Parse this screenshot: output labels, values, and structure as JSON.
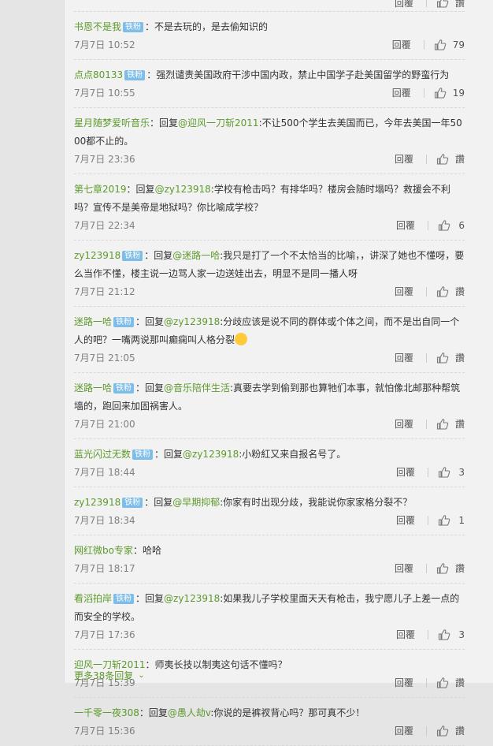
{
  "top_meta": {
    "reply_label": "回覆",
    "like_label": "讚"
  },
  "comments": [
    {
      "user": "书恩不是我",
      "badge": "铁粉",
      "reply_prefix": "",
      "mention": "",
      "content": "：不是去玩的，是去偷知识的",
      "time": "7月7日 10:52",
      "reply_label": "回覆",
      "likes": "79"
    },
    {
      "user": "点点80133",
      "badge": "铁粉",
      "reply_prefix": "",
      "mention": "",
      "content": "：强烈谴责美国政府干涉中国内政，禁止中国学子赴美国留学的野蛮行为",
      "time": "7月7日 10:55",
      "reply_label": "回覆",
      "likes": "19"
    },
    {
      "user": "星月随梦爱听音乐",
      "badge": "",
      "reply_prefix": "：回复",
      "mention": "@迎风一刀斩2011",
      "content": ":不让500个学生去美国而已，今年去美国一年5000都不止的。",
      "time": "7月7日 23:36",
      "reply_label": "回覆",
      "likes": "讚"
    },
    {
      "user": "第七章2019",
      "badge": "",
      "reply_prefix": "：回复",
      "mention": "@zy123918",
      "content": ":学校有枪击吗？有排华吗？楼房会随时塌吗？救援会不利吗？宣传不是美帝是地狱吗？你比喻成学校？",
      "time": "7月7日 22:34",
      "reply_label": "回覆",
      "likes": "6"
    },
    {
      "user": "zy123918",
      "badge": "铁粉",
      "reply_prefix": "：回复",
      "mention": "@迷路一哈",
      "content": ":我只是打了一个不太恰当的比喻，，讲深了她也不懂呀，要么当作不懂，楼主说一边骂人家一边送娃出去，明显不是同一播人呀",
      "time": "7月7日 21:12",
      "reply_label": "回覆",
      "likes": "讚"
    },
    {
      "user": "迷路一哈",
      "badge": "铁粉",
      "reply_prefix": "：回复",
      "mention": "@zy123918",
      "content": ":分歧应该是说不同的群体或个体之间，而不是出自同一个人的吧？一嘴两说那叫癫痫叫人格分裂",
      "time": "7月7日 21:05",
      "reply_label": "回覆",
      "likes": "讚",
      "emoji": true
    },
    {
      "user": "迷路一哈",
      "badge": "铁粉",
      "reply_prefix": "：回复",
      "mention": "@音乐陪伴生活",
      "content": ":真要去学到偷到那也算牠们本事，就怕像北邮那种帮筑墙的，跑回来加固祸害人。",
      "time": "7月7日 21:00",
      "reply_label": "回覆",
      "likes": "讚"
    },
    {
      "user": "蓝光闪过无数",
      "badge": "铁粉",
      "reply_prefix": "：回复",
      "mention": "@zy123918",
      "content": ":小粉紅又来自报名号了。",
      "time": "7月7日 18:44",
      "reply_label": "回覆",
      "likes": "3"
    },
    {
      "user": "zy123918",
      "badge": "铁粉",
      "reply_prefix": "：回复",
      "mention": "@早期抑郁",
      "content": ":你家有时出现分歧，我能说你家家格分裂不？",
      "time": "7月7日 18:34",
      "reply_label": "回覆",
      "likes": "1"
    },
    {
      "user": "网红微bo专家",
      "badge": "",
      "reply_prefix": "",
      "mention": "",
      "content": "：哈哈",
      "time": "7月7日 18:17",
      "reply_label": "回覆",
      "likes": "讚"
    },
    {
      "user": "看滔拍岸",
      "badge": "铁粉",
      "reply_prefix": "：回复",
      "mention": "@zy123918",
      "content": ":如果我儿子学校里面天天有枪击，我宁愿儿子上差一点的而安全的学校。",
      "time": "7月7日 17:36",
      "reply_label": "回覆",
      "likes": "3"
    },
    {
      "user": "迎风一刀斩2011",
      "badge": "",
      "reply_prefix": "",
      "mention": "",
      "content": "：师夷长技以制夷这句话不懂吗？",
      "time": "7月7日 15:39",
      "reply_label": "回覆",
      "likes": "讚"
    },
    {
      "user": "一千零一夜308",
      "badge": "",
      "reply_prefix": "：回复",
      "mention": "@愚人劫v",
      "content": ":你说的是裤衩背心吗？那可真不少！",
      "time": "7月7日 15:36",
      "reply_label": "回覆",
      "likes": "讚"
    }
  ],
  "more_replies": "更多38条回复",
  "icons": {
    "like": "thumbs-up-icon",
    "expand": "chevron-down-icon"
  }
}
